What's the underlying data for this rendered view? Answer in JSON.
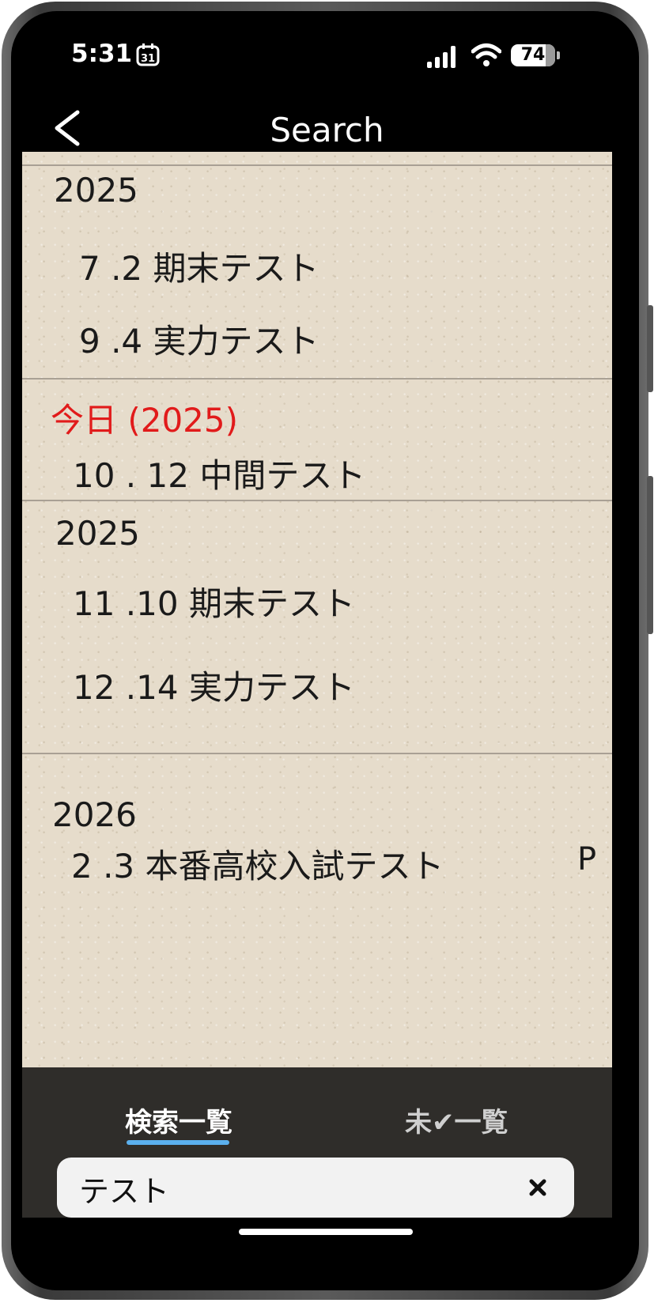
{
  "status_bar": {
    "time": "5:31",
    "calendar_icon_day": "31",
    "battery_level": "74"
  },
  "nav": {
    "title": "Search",
    "back_icon": "chevron-left-icon"
  },
  "groups": [
    {
      "year": "2025",
      "events": [
        {
          "date": "7 .2",
          "title": "期末テスト"
        },
        {
          "date": "9 .4",
          "title": "実力テスト"
        }
      ]
    },
    {
      "year": "今日 (2025)",
      "is_today": true,
      "events": [
        {
          "date": "10 . 12",
          "title": "中間テスト"
        }
      ]
    },
    {
      "year": "2025",
      "events": [
        {
          "date": "11 .10",
          "title": "期末テスト"
        },
        {
          "date": "12 .14",
          "title": "実力テスト"
        }
      ]
    },
    {
      "year": "2026",
      "events": [
        {
          "date": "2 .3",
          "title": "本番高校入試テスト",
          "flag": "P"
        }
      ]
    }
  ],
  "tabs": {
    "search_list": "検索一覧",
    "unchecked_list": "未✔一覧",
    "active": "search_list"
  },
  "search": {
    "value": "テスト",
    "clear_icon": "close-icon"
  },
  "colors": {
    "today": "#e11b1b",
    "tab_underline": "#5bb0ee",
    "paper": "#e6dccb"
  }
}
